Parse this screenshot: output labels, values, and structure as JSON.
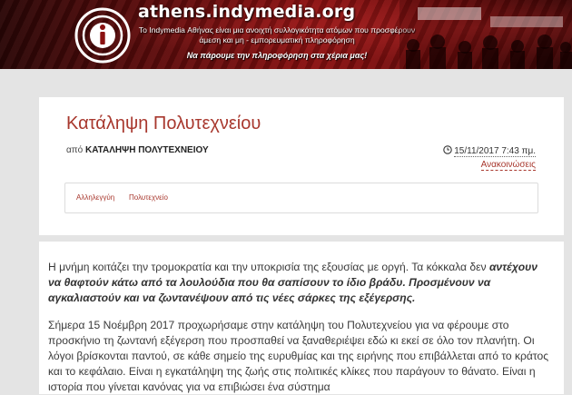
{
  "header": {
    "site_title": "athens.indymedia.org",
    "tagline": "Το Indymedia Αθήνας είναι μια ανοιχτή συλλογικότητα ατόμων που προσφέρουν άμεση και μη - εμπορευματική πληροφόρηση",
    "motto": "Να πάρουμε την πληροφόρηση στα χέρια μας!",
    "colors": {
      "banner": "#8a1010",
      "text": "#ffffff"
    }
  },
  "article": {
    "title": "Κατάληψη Πολυτεχνείου",
    "byline_prefix": "από",
    "author": "ΚΑΤΑΛΗΨΗ ΠΟΛΥΤΕΧΝΕΙΟΥ",
    "date": "15/11/2017 7:43 πμ.",
    "category": "Ανακοινώσεις",
    "tags": [
      "Αλληλεγγύη",
      "Πολυτεχνείο"
    ],
    "accent_color": "#a8382e"
  },
  "body": {
    "p1_start": "Η μνήμη κοιτάζει την τρομοκρατία και την υποκρισία της εξουσίας με οργή. Τα κόκκαλα δεν ",
    "p1_emphasis": "αντέχουν να θαφτούν κάτω από τα λουλούδια που θα σαπίσουν το ίδιο βράδυ. Προσμένουν να αγκαλιαστούν και να ζωντανέψουν από τις νέες σάρκες της εξέγερσης.",
    "p2": "Σήμερα 15 Νοέμβρη 2017 προχωρήσαμε στην κατάληψη του Πολυτεχνείου για να φέρουμε στο προσκήνιο τη ζωντανή εξέγερση που προσπαθεί να ξαναθεριέψει εδώ κι εκεί σε όλο τον πλανήτη. Οι λόγοι βρίσκονται παντού, σε κάθε σημείο της ευρυθμίας και της ειρήνης που επιβάλλεται από το κράτος και το κεφάλαιο. Είναι η εγκατάληψη της ζωής στις πολιτικές κλίκες που παράγουν το θάνατο. Είναι η ιστορία που γίνεται κανόνας για να επιβιώσει ένα σύστημα"
  },
  "icons": {
    "logo": "indymedia-logo-icon",
    "clock": "clock-icon"
  }
}
